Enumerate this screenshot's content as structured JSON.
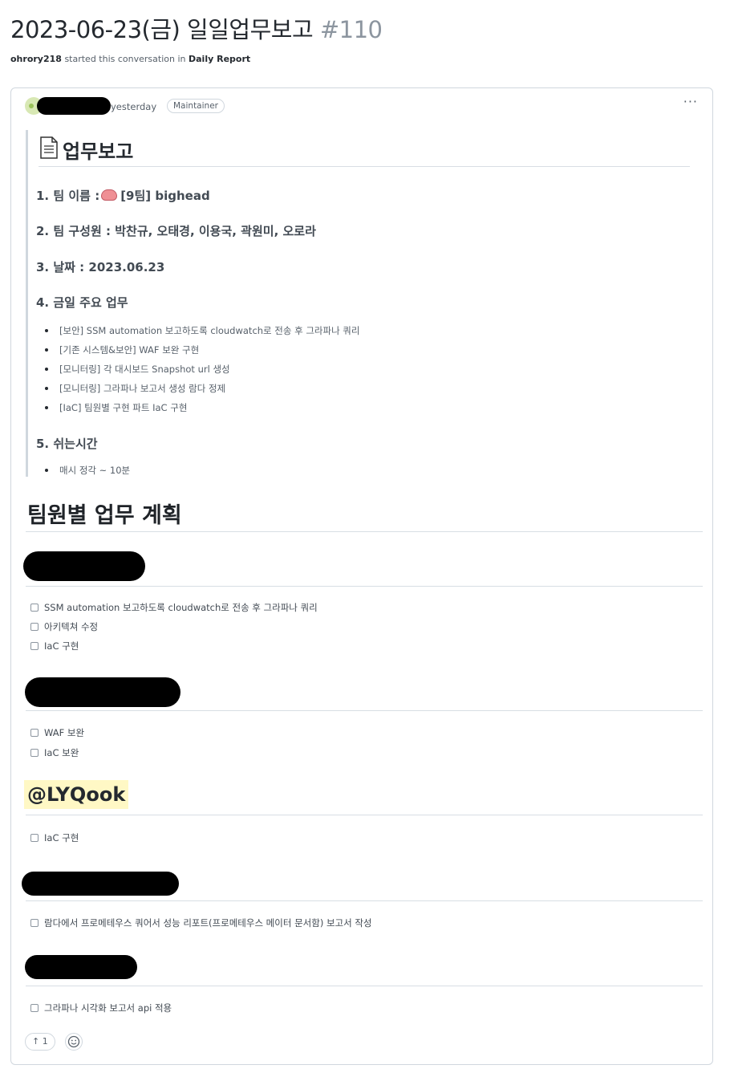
{
  "discussion": {
    "title": "2023-06-23(금) 일일업무보고",
    "number": "#110",
    "author": "ohrory218",
    "started_text": "started this conversation in",
    "category": "Daily Report"
  },
  "comment": {
    "time": "yesterday",
    "badge": "Maintainer",
    "more": "···",
    "report_title": "업무보고",
    "items": {
      "team_name_label": "1. 팀 이름 :",
      "team_name_value": "[9팀] bighead",
      "members": "2. 팀 구성원 : 박찬규, 오태경, 이용국, 곽원미, 오로라",
      "date": "3. 날짜 : 2023.06.23",
      "main_tasks": "4. 금일 주요 업무",
      "break": "5. 쉬는시간"
    },
    "main_task_bullets": [
      "[보안] SSM automation 보고하도록 cloudwatch로 전송 후 그라파나 쿼리",
      "[기존 시스템&보안] WAF 보완 구현",
      "[모니터링] 각 대시보드 Snapshot url 생성",
      "[모니터링] 그라파나 보고서 생성 람다 정제",
      "[IaC] 팀원별 구현 파트 IaC 구현"
    ],
    "break_bullets": [
      "매시 정각 ~ 10분"
    ],
    "plan_title": "팀원별 업무 계획",
    "plans": [
      {
        "tasks": [
          "SSM automation 보고하도록 cloudwatch로 전송 후 그라파나 쿼리",
          "아키텍쳐 수정",
          "IaC 구현"
        ]
      },
      {
        "tasks": [
          "WAF 보완",
          "IaC 보완"
        ]
      },
      {
        "member": "@LYQook",
        "tasks": [
          "IaC 구현"
        ]
      },
      {
        "tasks": [
          "람다에서 프로메테우스 쿼어서 성능 리포트(프로메테우스 메이터 문서함) 보고서 작성"
        ]
      },
      {
        "tasks": [
          "그라파나 시각화 보고서 api 적용"
        ]
      }
    ],
    "reaction": {
      "icon": "arrow-up-icon",
      "glyph": "↑",
      "count": "1"
    },
    "emoji_button_icon": "smiley-icon"
  }
}
